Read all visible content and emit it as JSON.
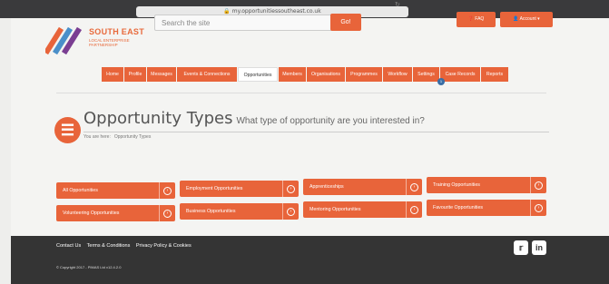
{
  "browser": {
    "url": "my.opportunitiessoutheast.co.uk",
    "reload_icon": "reload-icon"
  },
  "brand": {
    "name": "SOUTH EAST",
    "subtitle": "LOCAL ENTERPRISE PARTNERSHIP",
    "accent": "#e8643a"
  },
  "header": {
    "search_placeholder": "Search the site",
    "go_label": "Go!",
    "faq_label": "FAQ",
    "account_label": "Account"
  },
  "nav": {
    "items": [
      {
        "label": "Home"
      },
      {
        "label": "Profile"
      },
      {
        "label": "Messages"
      },
      {
        "label": "Events & Connections"
      },
      {
        "label": "Opportunities"
      },
      {
        "label": "Members"
      },
      {
        "label": "Organisations"
      },
      {
        "label": "Programmes"
      },
      {
        "label": "Workflow"
      },
      {
        "label": "Settings"
      },
      {
        "label": "Case Records"
      },
      {
        "label": "Reports"
      }
    ],
    "active": "Opportunities",
    "workflow_badge": "1"
  },
  "page": {
    "title": "Opportunity Types",
    "subtitle": "What type of opportunity are you interested in?",
    "breadcrumb_prefix": "You are here:",
    "breadcrumb_current": "Opportunity Types"
  },
  "tiles": [
    {
      "label": "All Opportunities"
    },
    {
      "label": "Employment Opportunities"
    },
    {
      "label": "Apprenticeships"
    },
    {
      "label": "Training Opportunities"
    },
    {
      "label": "Volunteering Opportunities"
    },
    {
      "label": "Business Opportunities"
    },
    {
      "label": "Mentoring Opportunities"
    },
    {
      "label": "Favourite Opportunities"
    }
  ],
  "footer": {
    "links": [
      "Contact Us",
      "Terms & Conditions",
      "Privacy Policy & Cookies"
    ],
    "copyright": "© Copyright 2017 - PIMAS Ltd v12.4.2.0",
    "social": [
      "twitter-icon",
      "linkedin-icon"
    ]
  }
}
